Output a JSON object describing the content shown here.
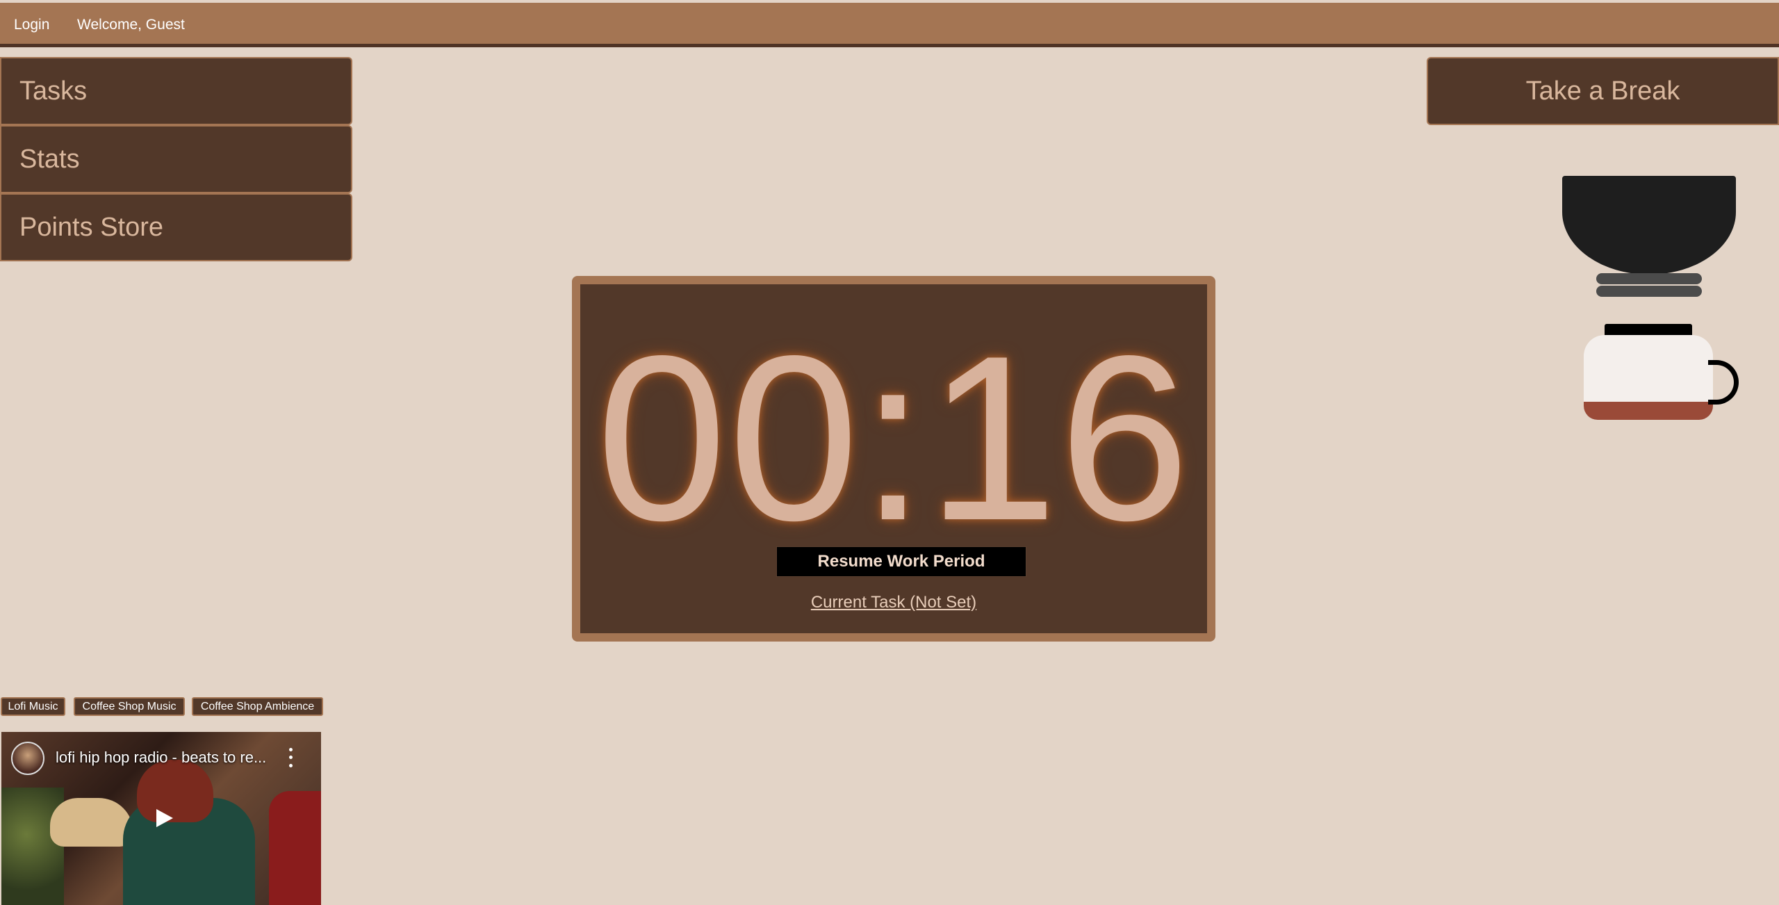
{
  "topbar": {
    "login_label": "Login",
    "welcome_text": "Welcome, Guest"
  },
  "nav": {
    "tasks_label": "Tasks",
    "stats_label": "Stats",
    "store_label": "Points Store"
  },
  "break_button_label": "Take a Break",
  "timer": {
    "time": "00:16",
    "resume_label": "Resume Work Period",
    "current_task_label": "Current Task (Not Set)"
  },
  "music": {
    "tabs": [
      "Lofi Music",
      "Coffee Shop Music",
      "Coffee Shop Ambience"
    ],
    "video_title": "lofi hip hop radio - beats to re..."
  },
  "colors": {
    "background": "#e3d4c7",
    "topbar": "#a47553",
    "panel": "#523829",
    "accent_text": "#d9b79d"
  },
  "icons": {
    "play": "play-icon",
    "more": "more-vert-icon",
    "coffee_maker": "coffee-maker-icon"
  }
}
